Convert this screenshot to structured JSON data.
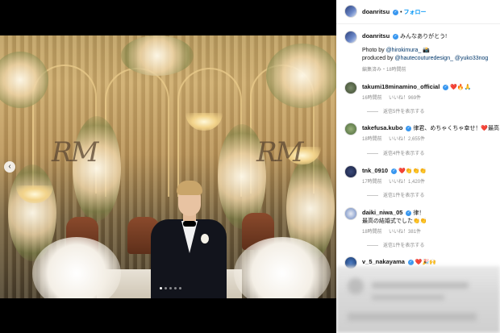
{
  "post": {
    "username": "doanritsu",
    "follow_label": "フォロー",
    "caption_username": "doanritsu",
    "caption_text": "みんなありがとう!",
    "credit_photo_prefix": "Photo by ",
    "credit_photo_handle": "@hirokimura_",
    "credit_photo_emoji": "📸",
    "credit_produced_prefix": "produced by ",
    "credit_produced_handles": "@hautecouturedesign_ @yuko33nog",
    "meta": "編集済み・18時間前"
  },
  "comments": [
    {
      "username": "takumi18minamino_official",
      "verified": true,
      "text": "❤️🔥🙏",
      "time": "16時間前",
      "likes": "いいね！969件",
      "replies": "返信5件を表示する"
    },
    {
      "username": "takefusa.kubo",
      "verified": true,
      "text": "律君、めちゃくちゃ幸せ！❤️最高",
      "time": "18時間前",
      "likes": "いいね！2,655件",
      "replies": "返信4件を表示する"
    },
    {
      "username": "tnk_0910",
      "verified": true,
      "text": "❤️👏👏👏",
      "time": "17時間前",
      "likes": "いいね！1,420件",
      "replies": "返信1件を表示する"
    },
    {
      "username": "daiki_niwa_05",
      "verified": true,
      "text": "律！",
      "text2": "最高の結婚式でした👏👏",
      "time": "18時間前",
      "likes": "いいね！381件",
      "replies": "返信1件を表示する"
    },
    {
      "username": "v_5_nakayama",
      "verified": true,
      "text": "❤️🎉🙌"
    }
  ],
  "photo": {
    "monogram_left": "RM",
    "monogram_right": "RM"
  },
  "carousel": {
    "count": 5,
    "active_index": 0,
    "prev_icon": "‹"
  },
  "colors": {
    "accent": "#0095f6",
    "verified": "#3897f0",
    "heart": "#ed4956"
  }
}
